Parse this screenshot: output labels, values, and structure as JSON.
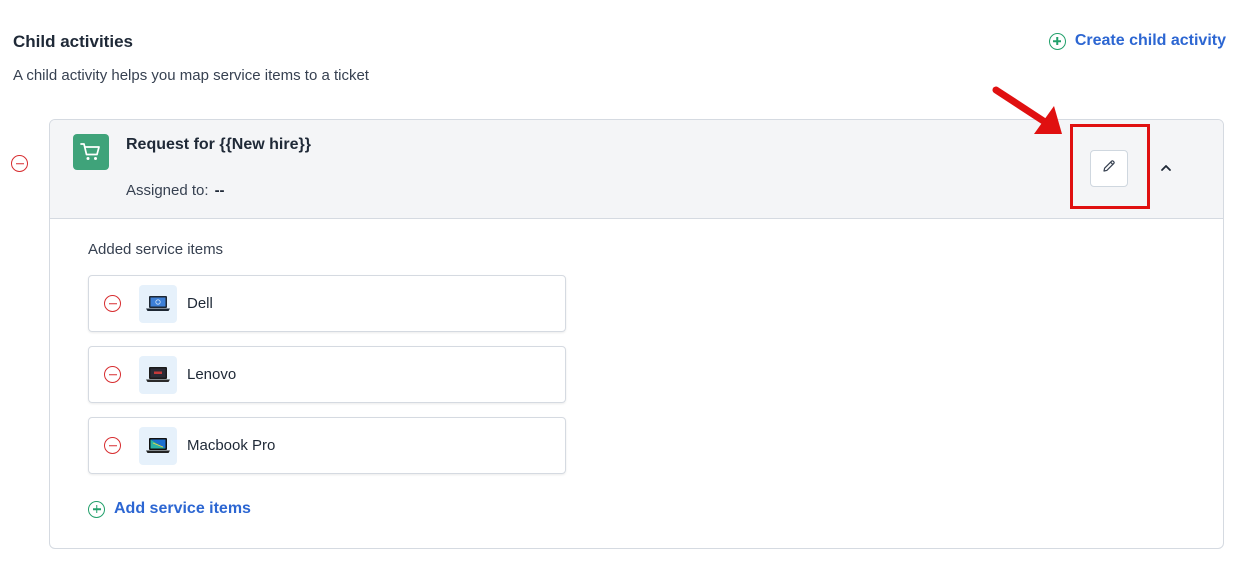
{
  "section": {
    "title": "Child activities",
    "description": "A child activity helps you map service items to a ticket",
    "create_link_label": "Create child activity"
  },
  "activity": {
    "title": "Request for {{New hire}}",
    "assigned_label": "Assigned to:",
    "assigned_value": "--",
    "icon": "shopping-cart-icon",
    "added_items_title": "Added service items",
    "items": [
      {
        "name": "Dell",
        "icon": "laptop-icon"
      },
      {
        "name": "Lenovo",
        "icon": "laptop-icon"
      },
      {
        "name": "Macbook Pro",
        "icon": "laptop-icon"
      }
    ],
    "add_items_label": "Add service items"
  },
  "colors": {
    "accent_link": "#2c66d2",
    "add_green": "#22a06b",
    "remove_red": "#d72d30",
    "cart_badge": "#3fa37a",
    "annotation_red": "#e01010"
  }
}
